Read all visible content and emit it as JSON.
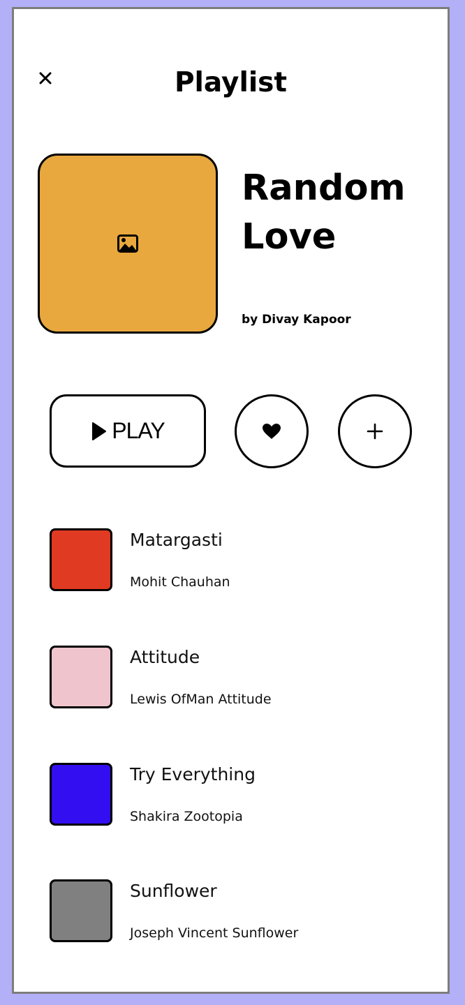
{
  "header": {
    "close_icon": "close-icon",
    "title": "Playlist"
  },
  "playlist": {
    "name": "Random Love",
    "author": "by Divay Kapoor",
    "cover_color": "#e8a83e",
    "cover_icon": "image-icon"
  },
  "actions": {
    "play_label": "PLAY",
    "play_icon": "play-icon",
    "like_icon": "heart-icon",
    "add_icon": "plus-icon"
  },
  "songs": [
    {
      "title": "Matargasti",
      "artist": "Mohit Chauhan",
      "color": "#e03a22"
    },
    {
      "title": "Attitude",
      "artist": "Lewis OfMan Attitude",
      "color": "#f0c4cc"
    },
    {
      "title": "Try Everything",
      "artist": "Shakira Zootopia",
      "color": "#330ef0"
    },
    {
      "title": "Sunflower",
      "artist": "Joseph Vincent Sunflower",
      "color": "#808080"
    }
  ]
}
